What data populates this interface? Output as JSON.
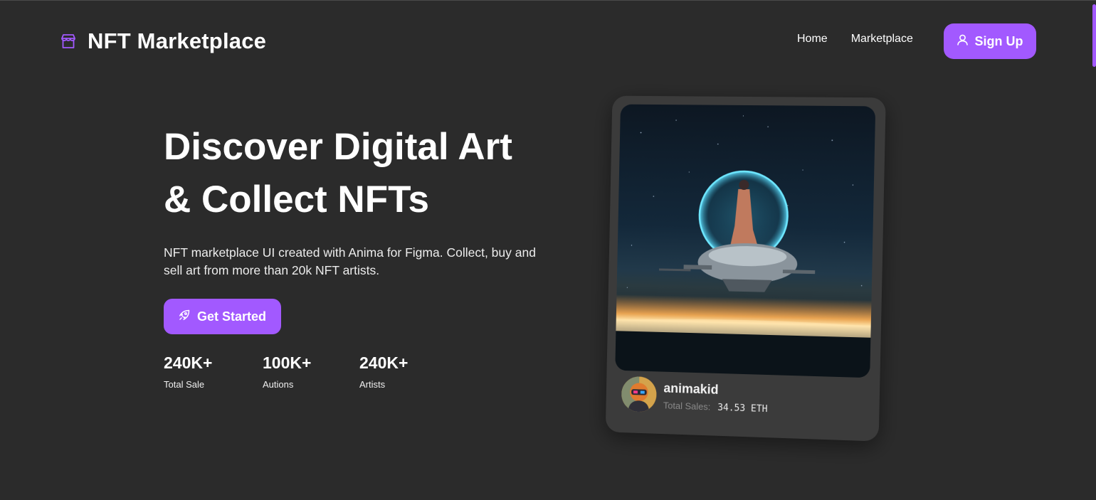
{
  "nav": {
    "brand_icon": "storefront-icon",
    "brand_title": "NFT Marketplace",
    "links": [
      "Home",
      "Marketplace"
    ],
    "signup_icon": "user-icon",
    "signup_label": "Sign Up"
  },
  "hero": {
    "title_line1": "Discover Digital Art",
    "title_line2": "& Collect NFTs",
    "description": "NFT marketplace UI created with Anima for Figma. Collect, buy and sell art from more than 20k NFT artists.",
    "cta_icon": "rocket-icon",
    "cta_label": "Get Started",
    "stats": [
      {
        "value": "240K+",
        "label": "Total Sale"
      },
      {
        "value": "100K+",
        "label": "Autions"
      },
      {
        "value": "240K+",
        "label": "Artists"
      }
    ]
  },
  "card": {
    "artist_name": "animakid",
    "sales_label": "Total Sales:",
    "sales_value": "34.53 ETH"
  },
  "colors": {
    "accent": "#a259ff",
    "background": "#2b2b2b",
    "card": "#3b3b3b"
  }
}
